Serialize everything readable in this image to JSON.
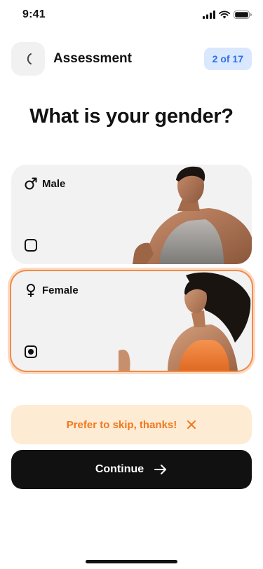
{
  "status_bar": {
    "time": "9:41",
    "icons": [
      "signal-icon",
      "wifi-icon",
      "battery-icon"
    ]
  },
  "header": {
    "title": "Assessment",
    "step": "2 of 17",
    "back_icon": "back-icon"
  },
  "question": "What is your gender?",
  "options": [
    {
      "label": "Male",
      "icon": "male-icon",
      "selected": false
    },
    {
      "label": "Female",
      "icon": "female-icon",
      "selected": true
    }
  ],
  "skip": {
    "label": "Prefer to skip, thanks!",
    "icon": "close-icon"
  },
  "continue": {
    "label": "Continue",
    "icon": "arrow-right-icon"
  },
  "colors": {
    "accent": "#f08b4b",
    "skip_bg": "#fdebd3",
    "skip_text": "#f0781e",
    "badge_bg": "#d9e8ff",
    "badge_text": "#2f6fe3",
    "button_dark": "#111111"
  }
}
